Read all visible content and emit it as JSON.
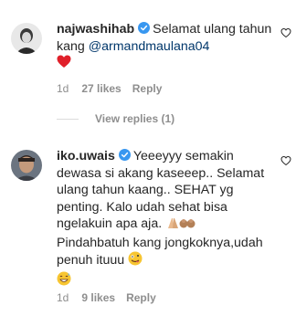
{
  "comments": [
    {
      "username": "najwashihab",
      "text_before": "Selamat ulang tahun kang ",
      "mention": "@armandmaulana04",
      "time": "1d",
      "likes": "27 likes",
      "reply": "Reply",
      "view_replies": "View replies (1)"
    },
    {
      "username": "iko.uwais",
      "text": "Yeeeyyy semakin dewasa si akang kaseeep.. Selamat ulang tahun kaang.. SEHAT yg penting. Kalo udah sehat bisa ngelakuin apa aja.",
      "text2": "Pindahbatuh kang jongkoknya,udah penuh ituuu",
      "time": "1d",
      "likes": "9 likes",
      "reply": "Reply"
    }
  ],
  "colors": {
    "text": "#262626",
    "meta": "#8e8e8e",
    "mention": "#00376b",
    "verified": "#3897f0",
    "heart": "#ed4956"
  }
}
